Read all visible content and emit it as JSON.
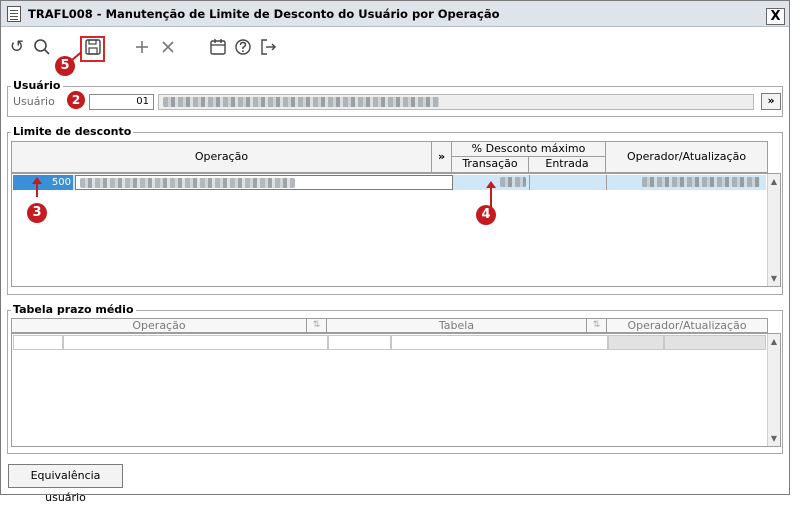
{
  "window": {
    "title": "TRAFL008 - Manutenção de Limite de Desconto do Usuário por Operação",
    "close_label": "X"
  },
  "toolbar": {
    "icons": [
      "undo-icon",
      "search-icon",
      "save-icon",
      "add-icon",
      "delete-icon",
      "calendar-icon",
      "help-icon",
      "exit-icon"
    ]
  },
  "annotations": {
    "badge_5": "5",
    "badge_2": "2",
    "badge_3": "3",
    "badge_4": "4"
  },
  "usuario": {
    "group_label": "Usuário",
    "field_label": "Usuário",
    "code_value": "01",
    "lookup_label": "»"
  },
  "limite": {
    "group_label": "Limite de desconto",
    "col_operacao": "Operação",
    "col_expand": "»",
    "col_desconto": "% Desconto máximo",
    "col_transacao": "Transação",
    "col_entrada": "Entrada",
    "col_operador": "Operador/Atualização",
    "row1_code": "500"
  },
  "tabela": {
    "group_label": "Tabela prazo médio",
    "col_operacao": "Operação",
    "col_tabela": "Tabela",
    "col_operador": "Operador/Atualização",
    "sort_glyph": "⇅"
  },
  "footer": {
    "equivalencia_label": "Equivalência usuário"
  },
  "colors": {
    "annotation_red": "#c31b1f",
    "selection_blue": "#3a8fd6"
  }
}
